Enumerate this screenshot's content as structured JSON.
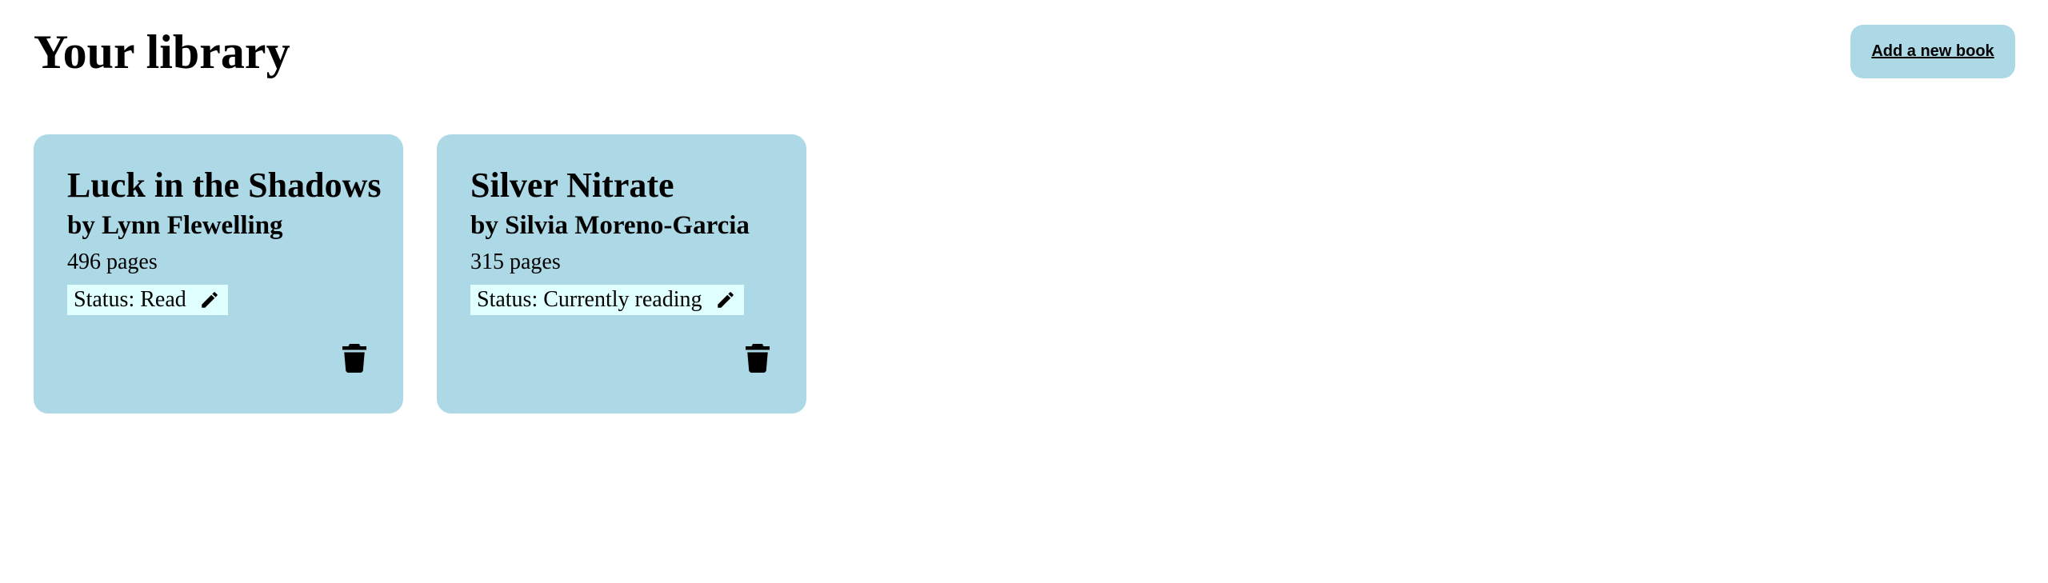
{
  "header": {
    "title": "Your library",
    "add_button_label": "Add a new book"
  },
  "books": [
    {
      "title": "Luck in the Shadows",
      "author": "by Lynn Flewelling",
      "pages": "496 pages",
      "status": "Status: Read",
      "edit_icon": "pencil-icon",
      "delete_icon": "trash-icon"
    },
    {
      "title": "Silver Nitrate",
      "author": "by Silvia Moreno-Garcia",
      "pages": "315 pages",
      "status": "Status: Currently reading",
      "edit_icon": "pencil-icon",
      "delete_icon": "trash-icon"
    }
  ],
  "colors": {
    "card_background": "#add8e6",
    "status_background": "#e0ffff",
    "button_background": "#add8e6"
  }
}
